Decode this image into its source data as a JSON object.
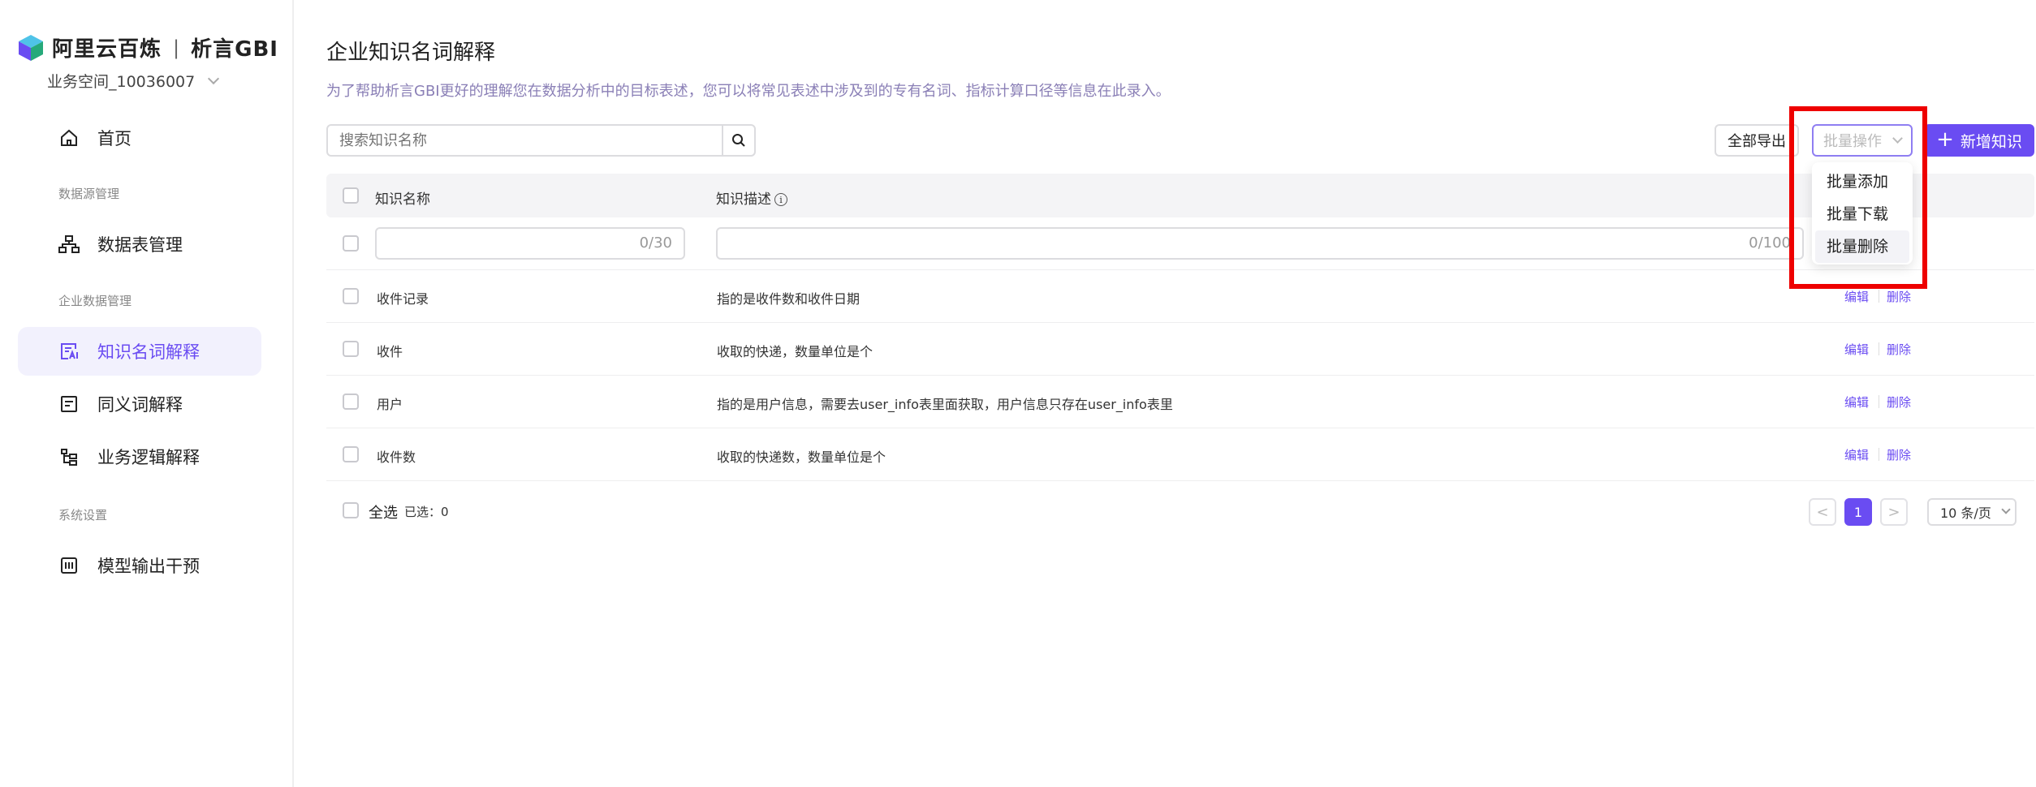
{
  "brand": {
    "name": "阿里云百炼",
    "sep": "|",
    "product": "析言GBI"
  },
  "workspace": {
    "name": "业务空间_10036007"
  },
  "sidebar": {
    "home": "首页",
    "group_datasource": "数据源管理",
    "table_mgmt": "数据表管理",
    "group_enterprise": "企业数据管理",
    "knowledge": "知识名词解释",
    "synonym": "同义词解释",
    "business_logic": "业务逻辑解释",
    "group_system": "系统设置",
    "model_output": "模型输出干预"
  },
  "page": {
    "title": "企业知识名词解释",
    "description": "为了帮助析言GBI更好的理解您在数据分析中的目标表述，您可以将常见表述中涉及到的专有名词、指标计算口径等信息在此录入。"
  },
  "search": {
    "placeholder": "搜索知识名称"
  },
  "toolbar": {
    "export_label": "全部导出",
    "batch_placeholder": "批量操作",
    "add_label": "新增知识",
    "batch_options": [
      "批量添加",
      "批量下载",
      "批量删除"
    ]
  },
  "table": {
    "headers": {
      "name": "知识名称",
      "description": "知识描述"
    },
    "new_row": {
      "name_count": "0/30",
      "desc_count": "0/100"
    },
    "rows": [
      {
        "name": "收件记录",
        "description": "指的是收件数和收件日期"
      },
      {
        "name": "收件",
        "description": "收取的快递，数量单位是个"
      },
      {
        "name": "用户",
        "description": "指的是用户信息，需要去user_info表里面获取，用户信息只存在user_info表里"
      },
      {
        "name": "收件数",
        "description": "收取的快递数，数量单位是个"
      }
    ],
    "actions": {
      "edit": "编辑",
      "delete": "删除"
    }
  },
  "footer": {
    "select_all": "全选",
    "selected": "已选：0",
    "current_page": "1",
    "prev": "<",
    "next": ">",
    "page_size": "10 条/页"
  },
  "colors": {
    "accent": "#6a4cf2",
    "highlight_box": "#ee0000"
  }
}
